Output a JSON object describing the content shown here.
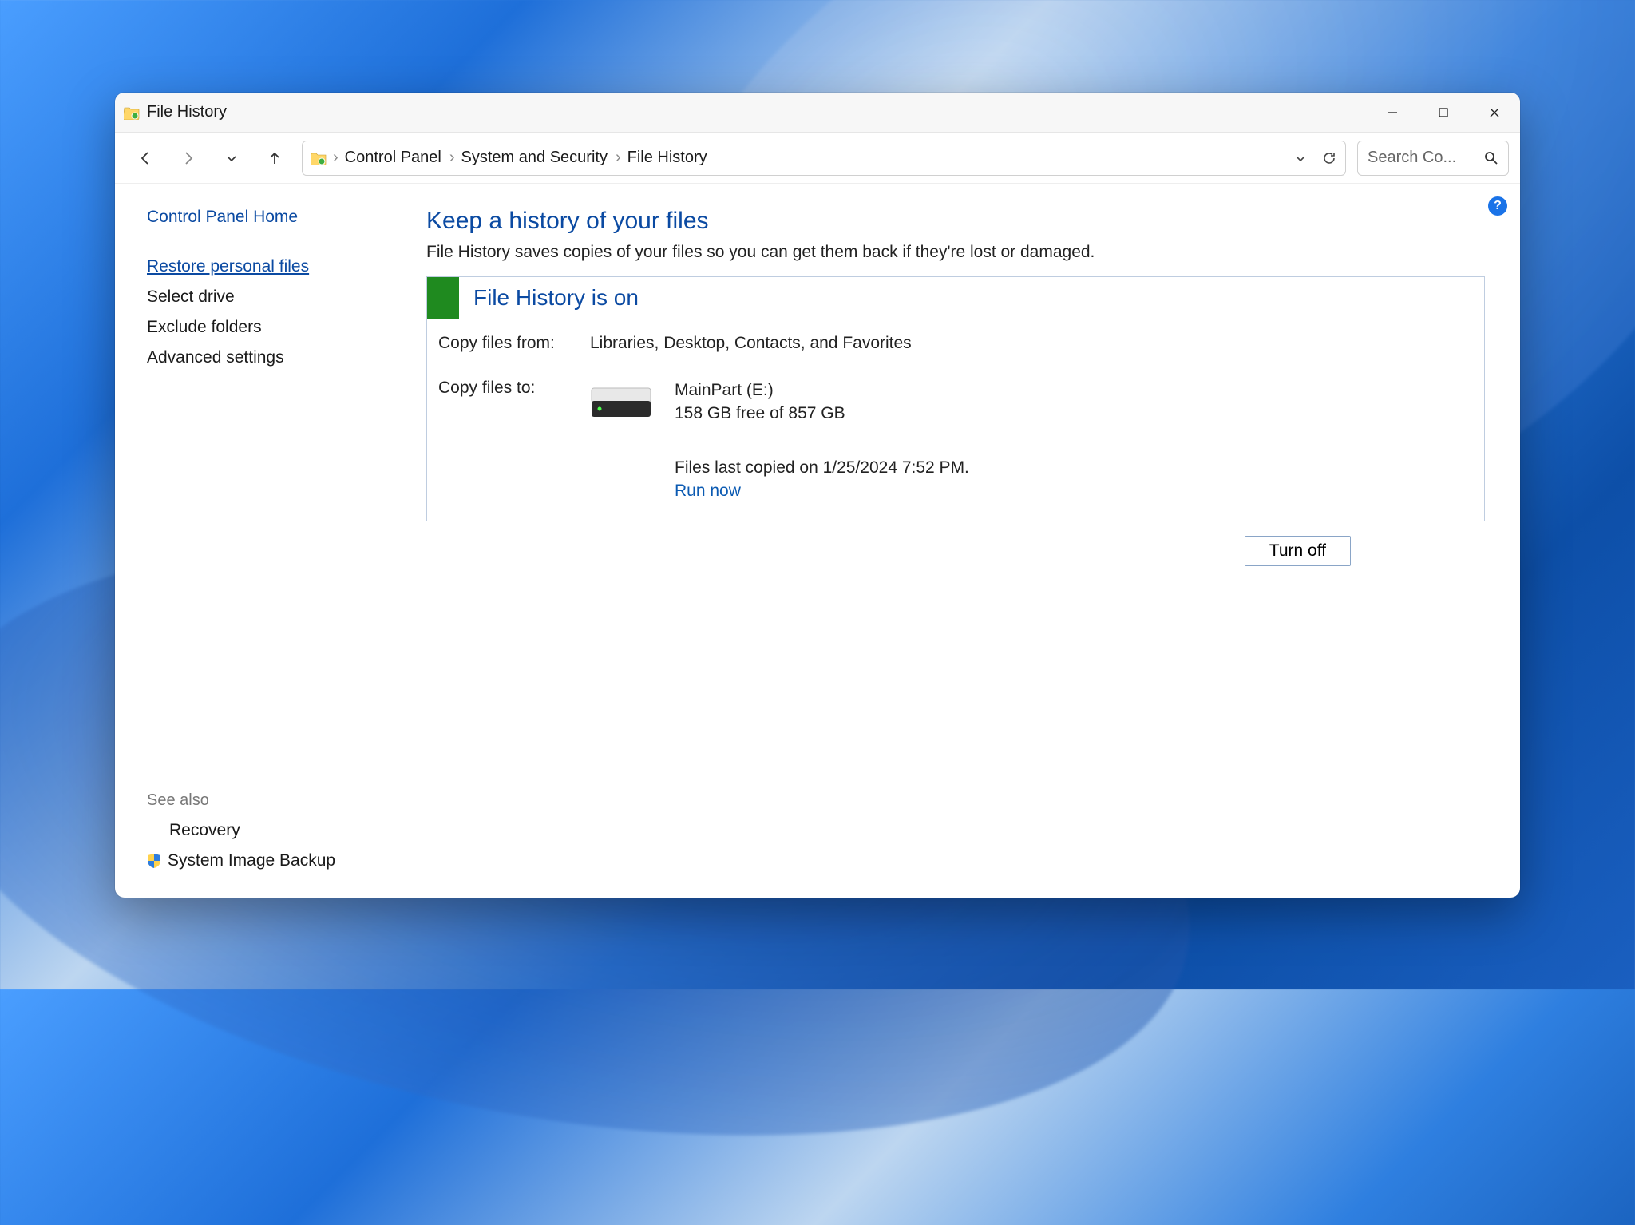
{
  "titlebar": {
    "title": "File History"
  },
  "breadcrumb": {
    "items": [
      "Control Panel",
      "System and Security",
      "File History"
    ]
  },
  "search": {
    "placeholder": "Search Co..."
  },
  "sidebar": {
    "home": "Control Panel Home",
    "items": [
      "Restore personal files",
      "Select drive",
      "Exclude folders",
      "Advanced settings"
    ],
    "see_also_hdr": "See also",
    "see_also": [
      "Recovery",
      "System Image Backup"
    ]
  },
  "main": {
    "heading": "Keep a history of your files",
    "subtext": "File History saves copies of your files so you can get them back if they're lost or damaged.",
    "status_label": "File History is on",
    "copy_from_label": "Copy files from:",
    "copy_from_value": "Libraries, Desktop, Contacts, and Favorites",
    "copy_to_label": "Copy files to:",
    "drive_name": "MainPart (E:)",
    "drive_space": "158 GB free of 857 GB",
    "last_copied": "Files last copied on 1/25/2024 7:52 PM.",
    "run_now": "Run now",
    "turn_off": "Turn off"
  }
}
